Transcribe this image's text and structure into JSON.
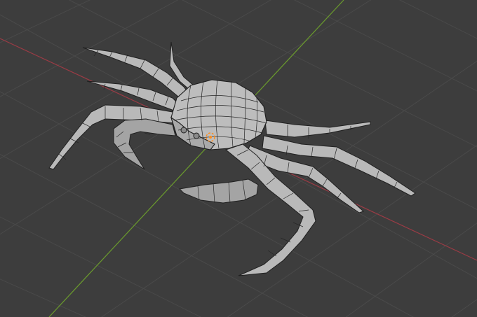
{
  "viewport": {
    "mode": "3d-viewport",
    "background": "#3d3d3d",
    "grid_color": "#4a4a4a",
    "x_axis_color": "#9b3b45",
    "y_axis_color": "#6a9a2d",
    "object": "crab-mesh",
    "display": "wireframe-overlay",
    "origin_marker_color": "#ff8c1a",
    "origin_marker_shown": true
  }
}
